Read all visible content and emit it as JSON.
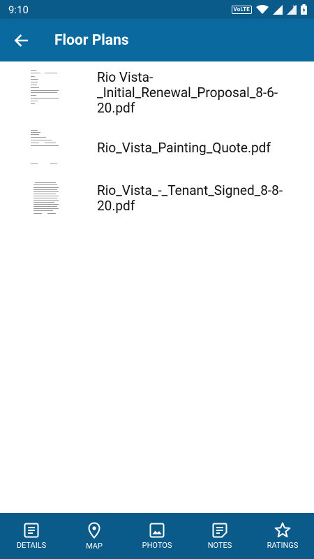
{
  "status": {
    "time": "9:10",
    "network_badge": "VoLTE"
  },
  "header": {
    "title": "Floor Plans"
  },
  "files": [
    {
      "name": "Rio Vista-_Initial_Renewal_Proposal_8-6-20.pdf",
      "line1": "Rio Vista-",
      "line2": "_Initial_Renewal_Proposal_8-6-",
      "line3": "20.pdf"
    },
    {
      "name": "Rio_Vista_Painting_Quote.pdf",
      "line1": "Rio_Vista_Painting_Quote.pdf"
    },
    {
      "name": "Rio_Vista_-_Tenant_Signed_8-8-20.pdf",
      "line1": "Rio_Vista_-_Tenant_Signed_8-8-",
      "line2": "20.pdf"
    }
  ],
  "bottom_nav": [
    {
      "label": "DETAILS",
      "icon": "details-icon"
    },
    {
      "label": "MAP",
      "icon": "map-pin-icon"
    },
    {
      "label": "PHOTOS",
      "icon": "photo-icon"
    },
    {
      "label": "NOTES",
      "icon": "notes-icon"
    },
    {
      "label": "RATINGS",
      "icon": "star-icon"
    }
  ],
  "colors": {
    "status_bar": "#0a5a8a",
    "app_bar": "#0a6aa0",
    "bottom_nav": "#0a5a8a"
  }
}
